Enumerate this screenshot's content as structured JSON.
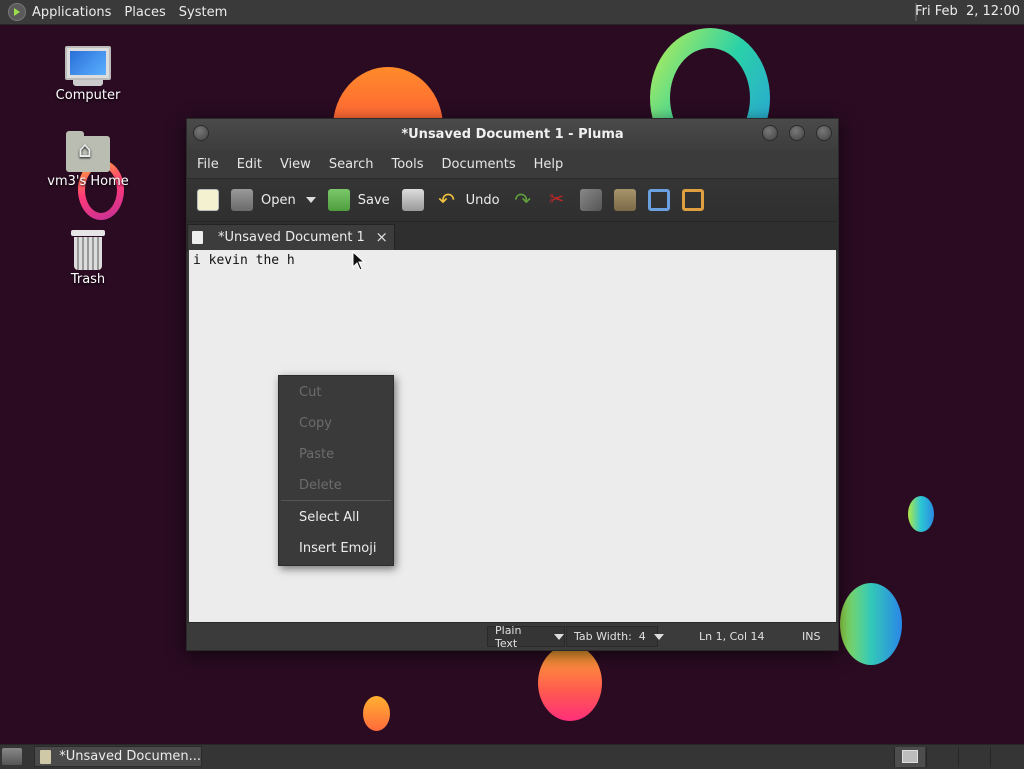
{
  "top_panel": {
    "menus": [
      "Applications",
      "Places",
      "System"
    ],
    "clock": "Fri Feb  2, 12:00"
  },
  "desktop_icons": [
    {
      "label": "Computer",
      "icon": "computer-icon"
    },
    {
      "label": "vm3's Home",
      "icon": "home-folder-icon"
    },
    {
      "label": "Trash",
      "icon": "trash-icon"
    }
  ],
  "window": {
    "title": "*Unsaved Document 1 - Pluma",
    "menu": [
      "File",
      "Edit",
      "View",
      "Search",
      "Tools",
      "Documents",
      "Help"
    ],
    "toolbar": {
      "open_label": "Open",
      "save_label": "Save",
      "undo_label": "Undo"
    },
    "tab": {
      "label": "*Unsaved Document 1",
      "close": "×"
    },
    "editor_text": "i kevin the h",
    "status": {
      "language": "Plain Text",
      "tab_width": "Tab Width:  4",
      "position": "Ln 1, Col 14",
      "mode": "INS"
    }
  },
  "context_menu": {
    "disabled_items": [
      "Cut",
      "Copy",
      "Paste",
      "Delete"
    ],
    "enabled_items": [
      "Select All",
      "Insert Emoji"
    ]
  },
  "taskbar": {
    "task_label": "*Unsaved Documen..."
  }
}
